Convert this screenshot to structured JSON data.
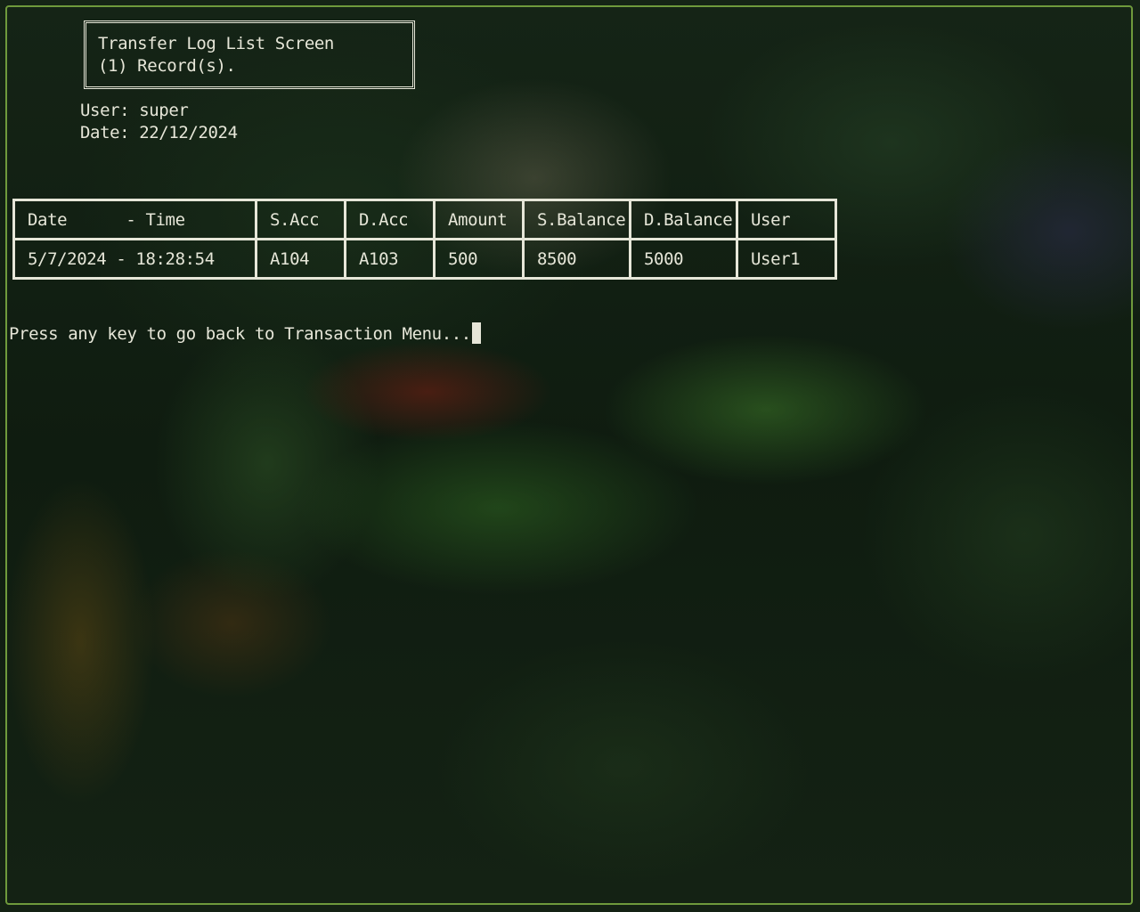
{
  "header": {
    "title": "Transfer Log List Screen",
    "record_count": "(1) Record(s)."
  },
  "session": {
    "user_line": "User: super",
    "date_line": "Date: 22/12/2024"
  },
  "table": {
    "columns": [
      "Date      - Time",
      "S.Acc",
      "D.Acc",
      "Amount",
      "S.Balance",
      "D.Balance",
      "User"
    ],
    "rows": [
      [
        "5/7/2024 - 18:28:54",
        "A104",
        "A103",
        "500",
        "8500",
        "5000",
        "User1"
      ]
    ]
  },
  "prompt": {
    "text": "Press any key to go back to Transaction Menu..."
  },
  "colors": {
    "text": "#e6e6d8",
    "frame": "#6f9a3c"
  }
}
